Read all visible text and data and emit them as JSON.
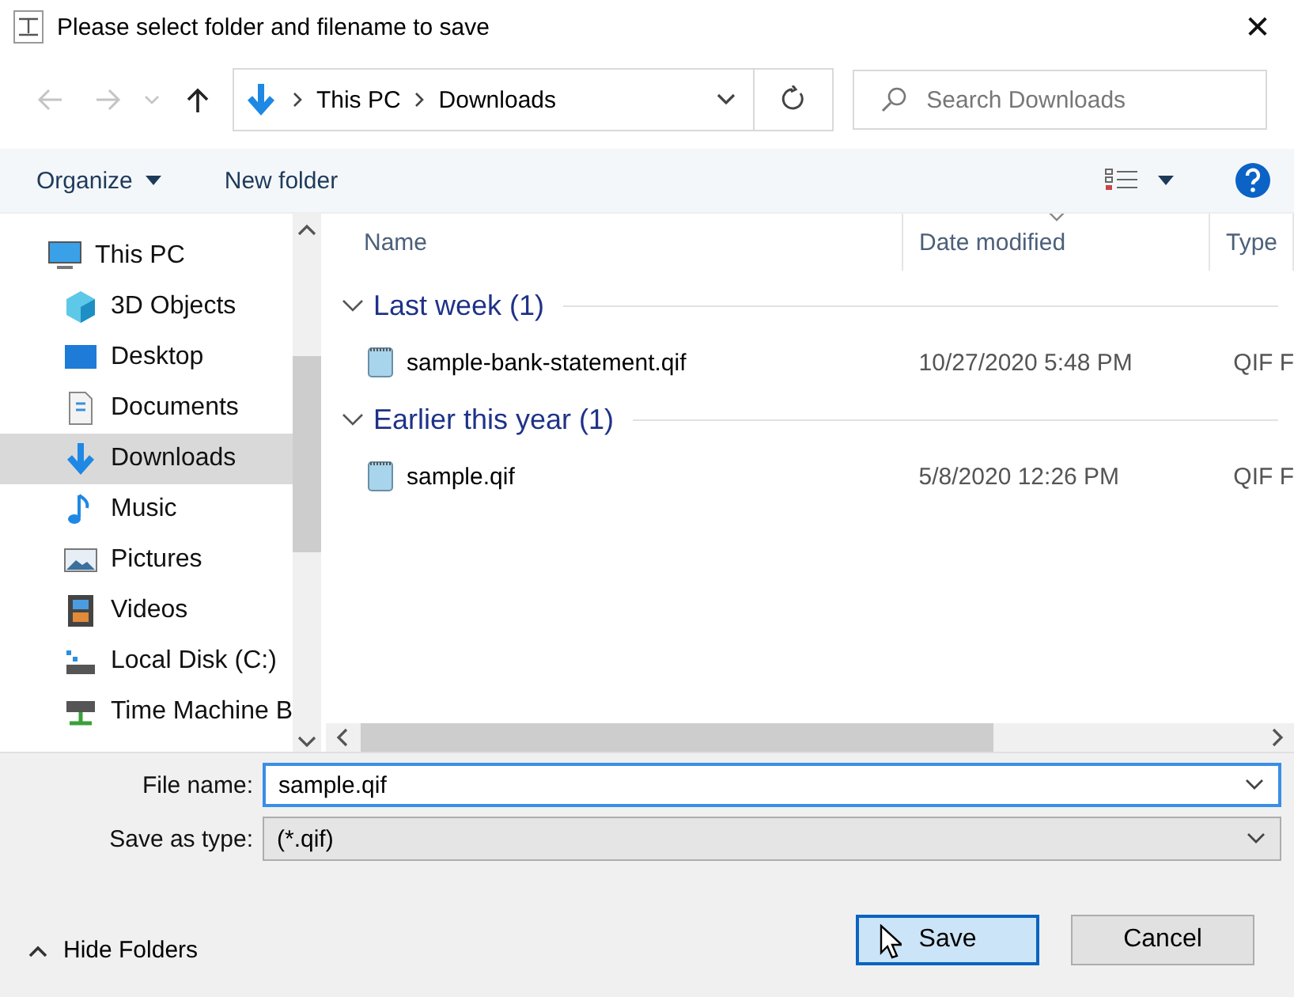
{
  "window": {
    "title": "Please select folder and filename to save",
    "close": "✕"
  },
  "nav_buttons": [
    {
      "kind": "back",
      "disabled": true
    },
    {
      "kind": "forward",
      "disabled": true
    },
    {
      "kind": "recent",
      "disabled": true
    },
    {
      "kind": "up",
      "disabled": false
    }
  ],
  "address": {
    "path": [
      "This PC",
      "Downloads"
    ]
  },
  "search": {
    "placeholder": "Search Downloads"
  },
  "toolbar": {
    "items": [
      {
        "label": "Organize",
        "kind": "menu"
      },
      {
        "label": "New folder",
        "kind": "button"
      }
    ]
  },
  "sidebar": {
    "items": [
      {
        "label": "This PC",
        "kind": "pc",
        "selected": false,
        "children": [
          {
            "label": "3D Objects",
            "kind": "cube",
            "selected": false
          },
          {
            "label": "Desktop",
            "kind": "desktop",
            "selected": false
          },
          {
            "label": "Documents",
            "kind": "documents",
            "selected": false
          },
          {
            "label": "Downloads",
            "kind": "downloads",
            "selected": true
          },
          {
            "label": "Music",
            "kind": "music",
            "selected": false
          },
          {
            "label": "Pictures",
            "kind": "pictures",
            "selected": false
          },
          {
            "label": "Videos",
            "kind": "videos",
            "selected": false
          },
          {
            "label": "Local Disk (C:)",
            "kind": "disk",
            "selected": false
          },
          {
            "label": "Time Machine B",
            "kind": "network",
            "selected": false
          }
        ]
      }
    ]
  },
  "files": {
    "columns": [
      {
        "label": "Name",
        "sorted": false
      },
      {
        "label": "Date modified",
        "sorted": true
      },
      {
        "label": "Type",
        "sorted": false
      }
    ],
    "groups": [
      {
        "label": "Last week (1)",
        "expanded": true,
        "rows": [
          {
            "name": "sample-bank-statement.qif",
            "date": "10/27/2020 5:48 PM",
            "type": "QIF F"
          }
        ]
      },
      {
        "label": "Earlier this year (1)",
        "expanded": true,
        "rows": [
          {
            "name": "sample.qif",
            "date": "5/8/2020 12:26 PM",
            "type": "QIF F"
          }
        ]
      }
    ]
  },
  "file_name": {
    "label": "File name:",
    "value": "sample.qif"
  },
  "save_as_type": {
    "label": "Save as type:",
    "value": "(*.qif)"
  },
  "hide_folders": {
    "label": "Hide Folders"
  },
  "buttons": [
    {
      "label": "Save",
      "kind": "primary"
    },
    {
      "label": "Cancel",
      "kind": "secondary"
    }
  ]
}
